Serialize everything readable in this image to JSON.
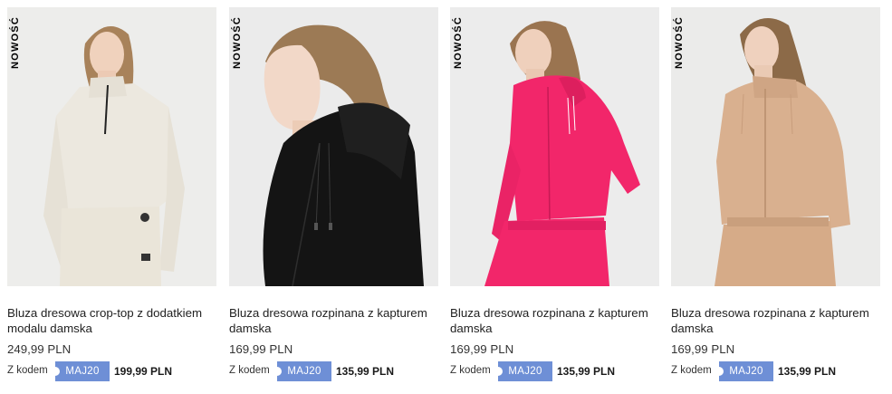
{
  "products": [
    {
      "badge": "NOWOŚĆ",
      "title": "Bluza dresowa crop-top z dodatkiem modalu damska",
      "price": "249,99 PLN",
      "code_label": "Z kodem",
      "code": "MAJ20",
      "code_price": "199,99 PLN",
      "garment_color": "#ece8df"
    },
    {
      "badge": "NOWOŚĆ",
      "title": "Bluza dresowa rozpinana z kapturem damska",
      "price": "169,99 PLN",
      "code_label": "Z kodem",
      "code": "MAJ20",
      "code_price": "135,99 PLN",
      "garment_color": "#141414"
    },
    {
      "badge": "NOWOŚĆ",
      "title": "Bluza dresowa rozpinana z kapturem damska",
      "price": "169,99 PLN",
      "code_label": "Z kodem",
      "code": "MAJ20",
      "code_price": "135,99 PLN",
      "garment_color": "#f2266a"
    },
    {
      "badge": "NOWOŚĆ",
      "title": "Bluza dresowa rozpinana z kapturem damska",
      "price": "169,99 PLN",
      "code_label": "Z kodem",
      "code": "MAJ20",
      "code_price": "135,99 PLN",
      "garment_color": "#d9b08f"
    }
  ],
  "colors": {
    "photo_background": "#ececec",
    "code_badge": "#6e8fd6",
    "text": "#222222"
  }
}
